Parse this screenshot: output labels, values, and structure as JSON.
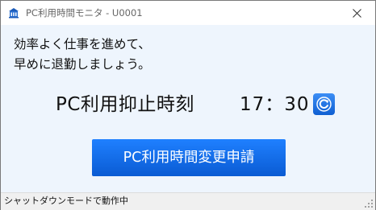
{
  "window": {
    "title": "PC利用時間モニタ - U0001"
  },
  "message": {
    "line1": "効率よく仕事を進めて、",
    "line2": "早めに退勤しましょう。"
  },
  "shutdown": {
    "label": "PC利用抑止時刻",
    "time": "17：30"
  },
  "primary_button": {
    "label": "PC利用時間変更申請"
  },
  "status": {
    "text": "シャットダウンモードで動作中"
  },
  "icons": {
    "app": "building-icon",
    "close": "close-icon",
    "refresh": "refresh-icon",
    "grip": "resize-grip-icon"
  },
  "colors": {
    "accent": "#0f6ee6",
    "window_background": "#eef5fd"
  }
}
